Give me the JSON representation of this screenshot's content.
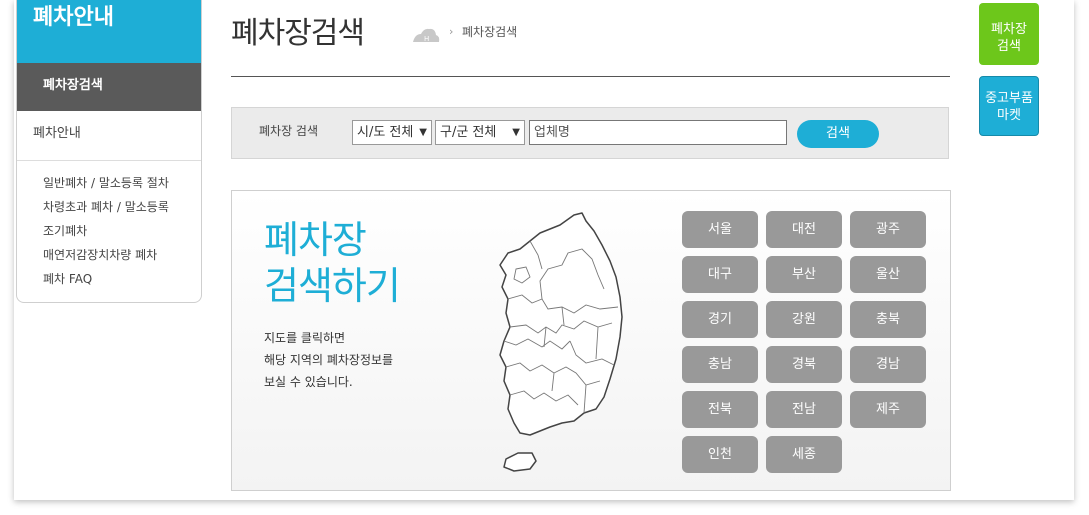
{
  "sidebar": {
    "title": "폐차안내",
    "active_item": "폐차장검색",
    "section": "폐차안내",
    "sub_items": [
      "일반폐차 / 말소등록 절차",
      "차령초과 폐차 / 말소등록",
      "조기폐차",
      "매연저감장치차량 폐차",
      "폐차 FAQ"
    ]
  },
  "header": {
    "title": "폐차장검색",
    "breadcrumb_home_icon": "home-icon",
    "breadcrumb_current": "폐차장검색"
  },
  "search": {
    "label": "폐차장 검색",
    "city_select": "시/도 전체",
    "district_select": "구/군 전체",
    "company_placeholder": "업체명",
    "button": "검색"
  },
  "map_panel": {
    "title_line1": "폐차장",
    "title_line2": "검색하기",
    "desc_line1": "지도를 클릭하면",
    "desc_line2": "해당 지역의 폐차장정보를",
    "desc_line3": "보실 수 있습니다.",
    "regions": [
      "서울",
      "대전",
      "광주",
      "대구",
      "부산",
      "울산",
      "경기",
      "강원",
      "충북",
      "충남",
      "경북",
      "경남",
      "전북",
      "전남",
      "제주",
      "인천",
      "세종"
    ]
  },
  "right_buttons": {
    "search": "폐차장 검색",
    "parts": "중고부품 마켓"
  },
  "colors": {
    "accent": "#1eaed6",
    "green": "#6dc71b",
    "region_button": "#999999",
    "sidebar_active": "#5a5a5a"
  }
}
